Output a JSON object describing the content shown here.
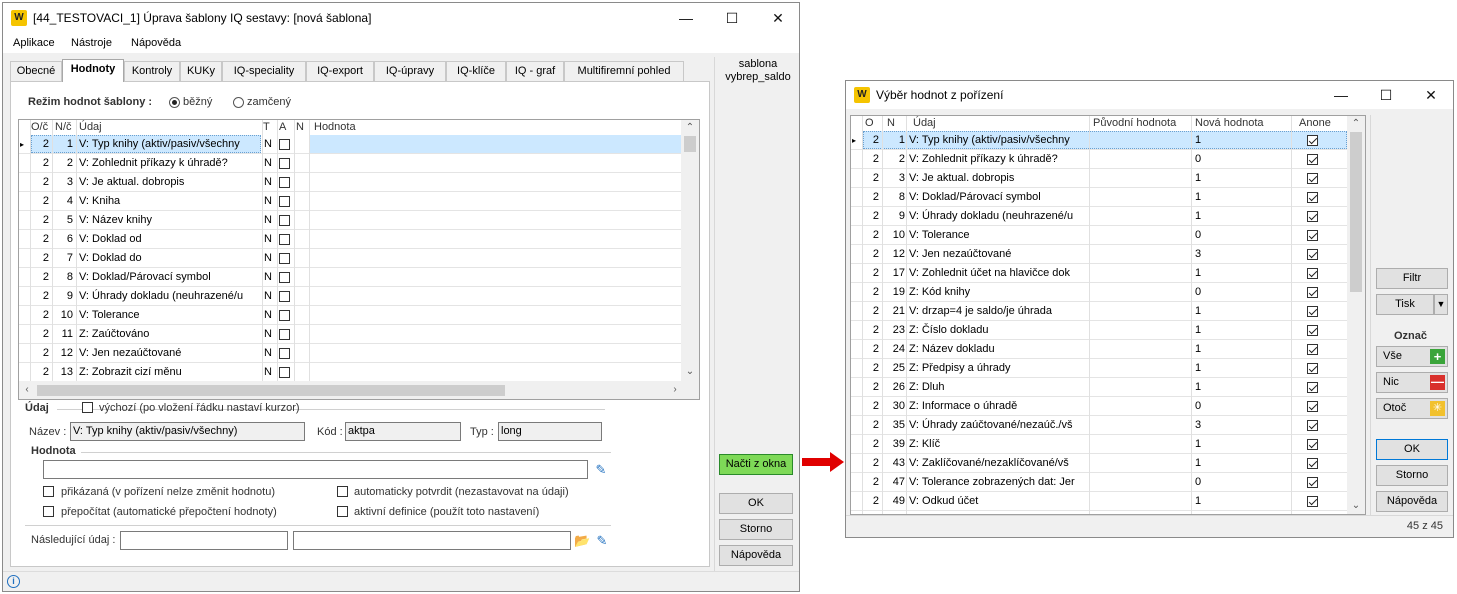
{
  "window1": {
    "title": "[44_TESTOVACI_1] Úprava šablony IQ sestavy: [nová šablona]",
    "menu": [
      "Aplikace",
      "Nástroje",
      "Nápověda"
    ],
    "tabs": [
      "Obecné",
      "Hodnoty",
      "Kontroly",
      "KUKy",
      "IQ-speciality",
      "IQ-export",
      "IQ-úpravy",
      "IQ-klíče",
      "IQ - graf",
      "Multifiremní pohled"
    ],
    "active_tab": "Hodnoty",
    "side_label_line1": "sablona",
    "side_label_line2": "vybrep_saldo",
    "mode_label": "Režim hodnot šablony :",
    "mode_options": [
      "běžný",
      "zamčený"
    ],
    "mode_selected": "běžný",
    "grid_headers": {
      "o": "O/č",
      "n": "N/č",
      "udaj": "Údaj",
      "t": "T",
      "a": "A",
      "nn": "N",
      "hodnota": "Hodnota"
    },
    "grid_rows": [
      {
        "o": "2",
        "n": "1",
        "udaj": "V: Typ knihy (aktiv/pasiv/všechny",
        "t": "N"
      },
      {
        "o": "2",
        "n": "2",
        "udaj": "V: Zohlednit příkazy k úhradě?",
        "t": "N"
      },
      {
        "o": "2",
        "n": "3",
        "udaj": "V: Je aktual. dobropis",
        "t": "N"
      },
      {
        "o": "2",
        "n": "4",
        "udaj": "V: Kniha",
        "t": "N"
      },
      {
        "o": "2",
        "n": "5",
        "udaj": "V: Název knihy",
        "t": "N"
      },
      {
        "o": "2",
        "n": "6",
        "udaj": "V: Doklad od",
        "t": "N"
      },
      {
        "o": "2",
        "n": "7",
        "udaj": "V: Doklad do",
        "t": "N"
      },
      {
        "o": "2",
        "n": "8",
        "udaj": "V: Doklad/Párovací symbol",
        "t": "N"
      },
      {
        "o": "2",
        "n": "9",
        "udaj": "V: Úhrady dokladu (neuhrazené/u",
        "t": "N"
      },
      {
        "o": "2",
        "n": "10",
        "udaj": "V: Tolerance",
        "t": "N"
      },
      {
        "o": "2",
        "n": "11",
        "udaj": "Z: Zaúčtováno",
        "t": "N"
      },
      {
        "o": "2",
        "n": "12",
        "udaj": "V: Jen nezaúčtované",
        "t": "N"
      },
      {
        "o": "2",
        "n": "13",
        "udaj": "Z: Zobrazit cizí měnu",
        "t": "N"
      }
    ],
    "udaj_group": {
      "title": "Údaj",
      "vychozi_label": "výchozí (po vložení řádku nastaví kurzor)",
      "nazev_label": "Název :",
      "nazev_value": "V: Typ knihy (aktiv/pasiv/všechny)",
      "kod_label": "Kód :",
      "kod_value": "aktpa",
      "typ_label": "Typ :",
      "typ_value": "long"
    },
    "hodnota_group": {
      "title": "Hodnota",
      "value": "",
      "prikazana": "přikázaná (v pořízení nelze změnit hodnotu)",
      "prepocitat": "přepočítat (automatické přepočtení hodnoty)",
      "auto_potvrdit": "automaticky potvrdit (nezastavovat na údaji)",
      "aktivni_definice": "aktivní definice (použít toto nastavení)"
    },
    "nasledujici_label": "Následující údaj :",
    "buttons": {
      "nacti": "Načti z okna",
      "ok": "OK",
      "storno": "Storno",
      "napoveda": "Nápověda"
    }
  },
  "window2": {
    "title": "Výběr hodnot z pořízení",
    "headers": {
      "o": "O",
      "n": "N",
      "udaj": "Údaj",
      "puvodni": "Původní hodnota",
      "nova": "Nová hodnota",
      "anone": "Anone"
    },
    "rows": [
      {
        "o": "2",
        "n": "1",
        "udaj": "V: Typ knihy (aktiv/pasiv/všechny",
        "nova": "1"
      },
      {
        "o": "2",
        "n": "2",
        "udaj": "V: Zohlednit příkazy k úhradě?",
        "nova": "0"
      },
      {
        "o": "2",
        "n": "3",
        "udaj": "V: Je aktual. dobropis",
        "nova": "1"
      },
      {
        "o": "2",
        "n": "8",
        "udaj": "V: Doklad/Párovací symbol",
        "nova": "1"
      },
      {
        "o": "2",
        "n": "9",
        "udaj": "V: Úhrady dokladu (neuhrazené/u",
        "nova": "1"
      },
      {
        "o": "2",
        "n": "10",
        "udaj": "V: Tolerance",
        "nova": "0"
      },
      {
        "o": "2",
        "n": "12",
        "udaj": "V: Jen nezaúčtované",
        "nova": "3"
      },
      {
        "o": "2",
        "n": "17",
        "udaj": "V: Zohlednit účet na hlavičce dok",
        "nova": "1"
      },
      {
        "o": "2",
        "n": "19",
        "udaj": "Z: Kód knihy",
        "nova": "0"
      },
      {
        "o": "2",
        "n": "21",
        "udaj": "V: drzap=4 je saldo/je úhrada",
        "nova": "1"
      },
      {
        "o": "2",
        "n": "23",
        "udaj": "Z: Číslo dokladu",
        "nova": "1"
      },
      {
        "o": "2",
        "n": "24",
        "udaj": "Z: Název dokladu",
        "nova": "1"
      },
      {
        "o": "2",
        "n": "25",
        "udaj": "Z: Předpisy a úhrady",
        "nova": "1"
      },
      {
        "o": "2",
        "n": "26",
        "udaj": "Z: Dluh",
        "nova": "1"
      },
      {
        "o": "2",
        "n": "30",
        "udaj": "Z: Informace o úhradě",
        "nova": "0"
      },
      {
        "o": "2",
        "n": "35",
        "udaj": "V: Úhrady zaúčtované/nezaúč./vš",
        "nova": "3"
      },
      {
        "o": "2",
        "n": "39",
        "udaj": "Z: Klíč",
        "nova": "1"
      },
      {
        "o": "2",
        "n": "43",
        "udaj": "V: Zaklíčované/nezaklíčované/vš",
        "nova": "1"
      },
      {
        "o": "2",
        "n": "47",
        "udaj": "V: Tolerance zobrazených dat: Jer",
        "nova": "0"
      },
      {
        "o": "2",
        "n": "49",
        "udaj": "V: Odkud účet",
        "nova": "1"
      }
    ],
    "buttons": {
      "filtr": "Filtr",
      "tisk": "Tisk",
      "oznac": "Označ",
      "vse": "Vše",
      "nic": "Nic",
      "otoc": "Otoč",
      "ok": "OK",
      "storno": "Storno",
      "napoveda": "Nápověda"
    },
    "count": "45 z 45"
  },
  "colors": {
    "selection": "#cce8ff",
    "accent_green": "#7ed957",
    "arrow_red": "#e00000",
    "ok_border": "#0078d7"
  }
}
